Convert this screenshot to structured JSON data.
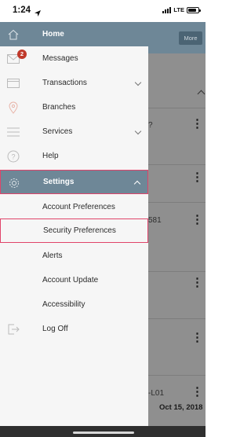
{
  "status_bar": {
    "time": "1:24",
    "network": "LTE"
  },
  "background": {
    "more_button": "More",
    "rows": [
      {
        "text": ""
      },
      {
        "text": "?"
      },
      {
        "text": ""
      },
      {
        "text": "581"
      },
      {
        "text": ""
      },
      {
        "text": ""
      },
      {
        "text": "-L01"
      }
    ],
    "last_date": "Oct 15, 2018"
  },
  "menu": {
    "items": [
      {
        "label": "Home",
        "icon": "home-icon"
      },
      {
        "label": "Messages",
        "icon": "mail-icon",
        "badge": "2"
      },
      {
        "label": "Transactions",
        "icon": "card-icon"
      },
      {
        "label": "Branches",
        "icon": "location-pin-icon"
      },
      {
        "label": "Services",
        "icon": "list-icon"
      },
      {
        "label": "Help",
        "icon": "help-icon"
      },
      {
        "label": "Settings",
        "icon": "gear-icon"
      },
      {
        "label": "Log Off",
        "icon": "logout-icon"
      }
    ],
    "settings_sub": [
      {
        "label": "Account Preferences"
      },
      {
        "label": "Security Preferences"
      },
      {
        "label": "Alerts"
      },
      {
        "label": "Account Update"
      },
      {
        "label": "Accessibility"
      }
    ]
  },
  "colors": {
    "active_bg": "#6e8797",
    "highlight_border": "#e0446a",
    "badge": "#c0392b"
  }
}
